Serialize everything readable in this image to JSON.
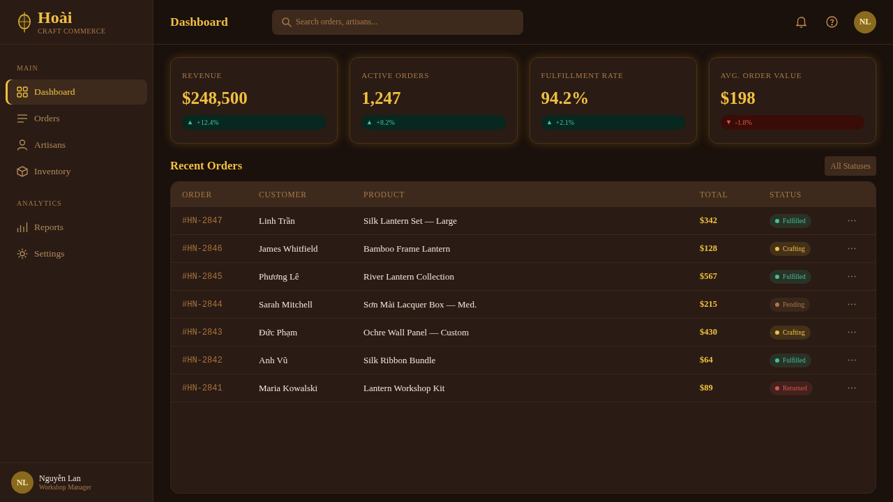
{
  "sidebar": {
    "brand": {
      "name": "Hoài",
      "tagline": "CRAFT COMMERCE"
    },
    "sections": [
      {
        "title": "MAIN",
        "items": [
          {
            "label": "Dashboard",
            "selected": true
          },
          {
            "label": "Orders",
            "selected": false
          },
          {
            "label": "Artisans",
            "selected": false
          },
          {
            "label": "Inventory",
            "selected": false
          }
        ]
      },
      {
        "title": "ANALYTICS",
        "items": [
          {
            "label": "Reports",
            "selected": false
          },
          {
            "label": "Settings",
            "selected": false
          }
        ]
      }
    ],
    "user": {
      "initials": "NL",
      "name": "Nguyễn Lan",
      "role": "Workshop Manager"
    }
  },
  "header": {
    "title": "Dashboard",
    "search": {
      "placeholder": "Search orders, artisans..."
    },
    "avatar": "NL"
  },
  "stats": [
    {
      "label": "REVENUE",
      "value": "$248,500",
      "change": {
        "kind": "up",
        "text": "+12.4%"
      }
    },
    {
      "label": "ACTIVE ORDERS",
      "value": "1,247",
      "change": {
        "kind": "up",
        "text": "+8.2%"
      }
    },
    {
      "label": "FULFILLMENT RATE",
      "value": "94.2%",
      "change": {
        "kind": "up",
        "text": "+2.1%"
      }
    },
    {
      "label": "AVG. ORDER VALUE",
      "value": "$198",
      "change": {
        "kind": "down",
        "text": "-1.8%"
      }
    }
  ],
  "orders": {
    "title": "Recent Orders",
    "filter": "All Statuses",
    "columns": [
      "ORDER",
      "CUSTOMER",
      "PRODUCT",
      "TOTAL",
      "STATUS"
    ],
    "rows": [
      {
        "order": "#HN-2847",
        "customer": "Linh Trần",
        "product": "Silk Lantern Set — Large",
        "total": "$342",
        "status": {
          "label": "Fulfilled",
          "color": "#3cc49a"
        }
      },
      {
        "order": "#HN-2846",
        "customer": "James Whitfield",
        "product": "Bamboo Frame Lantern",
        "total": "$128",
        "status": {
          "label": "Crafting",
          "color": "#f0c040"
        }
      },
      {
        "order": "#HN-2845",
        "customer": "Phương Lê",
        "product": "River Lantern Collection",
        "total": "$567",
        "status": {
          "label": "Fulfilled",
          "color": "#3cc49a"
        }
      },
      {
        "order": "#HN-2844",
        "customer": "Sarah Mitchell",
        "product": "Sơn Mài Lacquer Box — Med.",
        "total": "$215",
        "status": {
          "label": "Pending",
          "color": "#a87a4a"
        }
      },
      {
        "order": "#HN-2843",
        "customer": "Đức Phạm",
        "product": "Ochre Wall Panel — Custom",
        "total": "$430",
        "status": {
          "label": "Crafting",
          "color": "#f0c040"
        }
      },
      {
        "order": "#HN-2842",
        "customer": "Anh Vũ",
        "product": "Silk Ribbon Bundle",
        "total": "$64",
        "status": {
          "label": "Fulfilled",
          "color": "#3cc49a"
        }
      },
      {
        "order": "#HN-2841",
        "customer": "Maria Kowalski",
        "product": "Lantern Workshop Kit",
        "total": "$89",
        "status": {
          "label": "Returned",
          "color": "#e05050"
        }
      }
    ]
  }
}
